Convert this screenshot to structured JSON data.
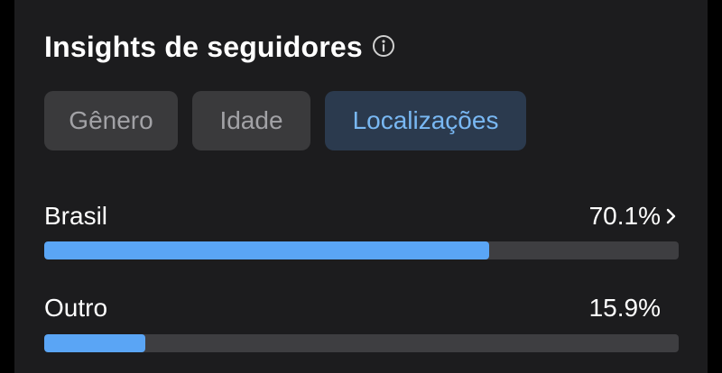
{
  "header": {
    "title": "Insights de seguidores",
    "info_icon": "info-circle-icon"
  },
  "tabs": [
    {
      "label": "Gênero",
      "selected": false
    },
    {
      "label": "Idade",
      "selected": false
    },
    {
      "label": "Localizações",
      "selected": true
    }
  ],
  "locations": [
    {
      "label": "Brasil",
      "value": "70.1%",
      "fraction": 0.701,
      "has_chevron": true
    },
    {
      "label": "Outro",
      "value": "15.9%",
      "fraction": 0.159,
      "has_chevron": false
    }
  ],
  "colors": {
    "background": "#1c1c1e",
    "tab_bg": "#3a3a3c",
    "tab_selected_bg": "#2b3a4e",
    "tab_selected_text": "#79b8f3",
    "bar_track": "#3e3e41",
    "bar_fill": "#5aa5f5"
  }
}
